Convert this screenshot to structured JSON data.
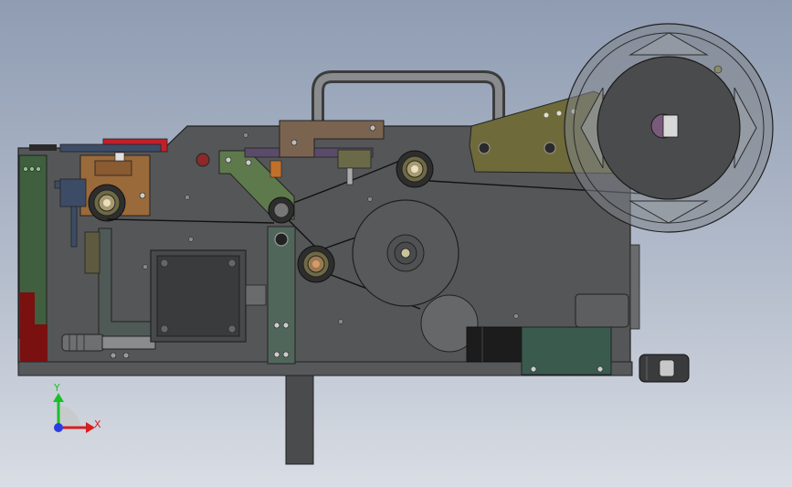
{
  "viewport": {
    "background_top": "#8f9cb2",
    "background_bottom": "#d9dde4"
  },
  "model": {
    "frame_color": "#555657",
    "frame_edge_color": "#222222",
    "accent_colors": {
      "olive_arm": "#6f6a3a",
      "orange_block": "#9a6a3a",
      "red_block": "#c41e2a",
      "green_panel": "#3f5f3f",
      "teal_box": "#3a5a4e",
      "brown_bracket": "#7a6450",
      "purple_hub": "#7a5a7a"
    }
  },
  "triad": {
    "y_label": "Y",
    "x_label": "X",
    "y_color": "#1bbf2a",
    "x_color": "#d81e1e",
    "z_color": "#2b3de0"
  }
}
